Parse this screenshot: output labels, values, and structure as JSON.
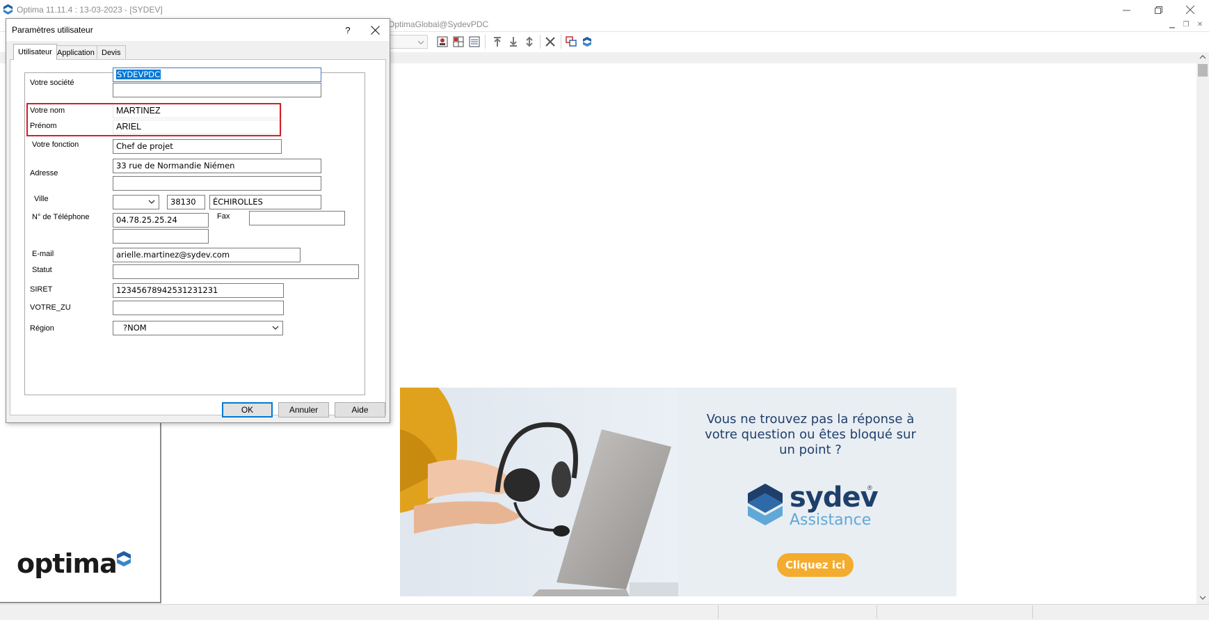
{
  "window": {
    "title": "Optima 11.11.4 : 13-03-2023 - [SYDEV]",
    "connection": "OptimaGlobal@SydevPDC"
  },
  "dialog": {
    "title": "Paramètres utilisateur",
    "help": "?",
    "tabs": [
      {
        "label": "Utilisateur",
        "active": true
      },
      {
        "label": "Application",
        "active": false
      },
      {
        "label": "Devis",
        "active": false
      }
    ],
    "labels": {
      "societe": "Votre société",
      "nom": "Votre nom",
      "prenom": "Prénom",
      "fonction": "Votre fonction",
      "adresse": "Adresse",
      "ville": "Ville",
      "telephone": "N° de Téléphone",
      "fax": "Fax",
      "email": "E-mail",
      "statut": "Statut",
      "siret": "SIRET",
      "votre_zu": "VOTRE_ZU",
      "region": "Région"
    },
    "values": {
      "societe": "SYDEVPDC",
      "societe2": "",
      "nom": "MARTINEZ",
      "prenom": "ARIEL",
      "fonction": "Chef de projet",
      "adresse1": "33 rue de Normandie Niémen",
      "adresse2": "",
      "pays": "",
      "code_postal": "38130",
      "ville": "ÉCHIROLLES",
      "telephone": "04.78.25.25.24",
      "telephone2": "",
      "fax": "",
      "email": "arielle.martinez@sydev.com",
      "statut": "",
      "siret": "12345678942531231231",
      "votre_zu": "",
      "region": "?NOM"
    },
    "buttons": {
      "ok": "OK",
      "cancel": "Annuler",
      "help": "Aide"
    }
  },
  "banner": {
    "text": "Vous ne trouvez pas la réponse à votre question ou êtes bloqué sur un point ?",
    "brand": "sydev",
    "brand_mark": "®",
    "subtitle": "Assistance",
    "cta": "Cliquez ici"
  },
  "logo": {
    "text": "optima"
  },
  "colors": {
    "highlight": "#d01f2a",
    "selection": "#0078d7",
    "brand_navy": "#1f3f6b",
    "brand_light_blue": "#5fa8d8",
    "cta_orange": "#f4ac2e"
  },
  "icons": [
    "sydev-logo-icon",
    "minimize-icon",
    "restore-icon",
    "close-icon",
    "chevron-down-icon",
    "toolbar-icons"
  ]
}
